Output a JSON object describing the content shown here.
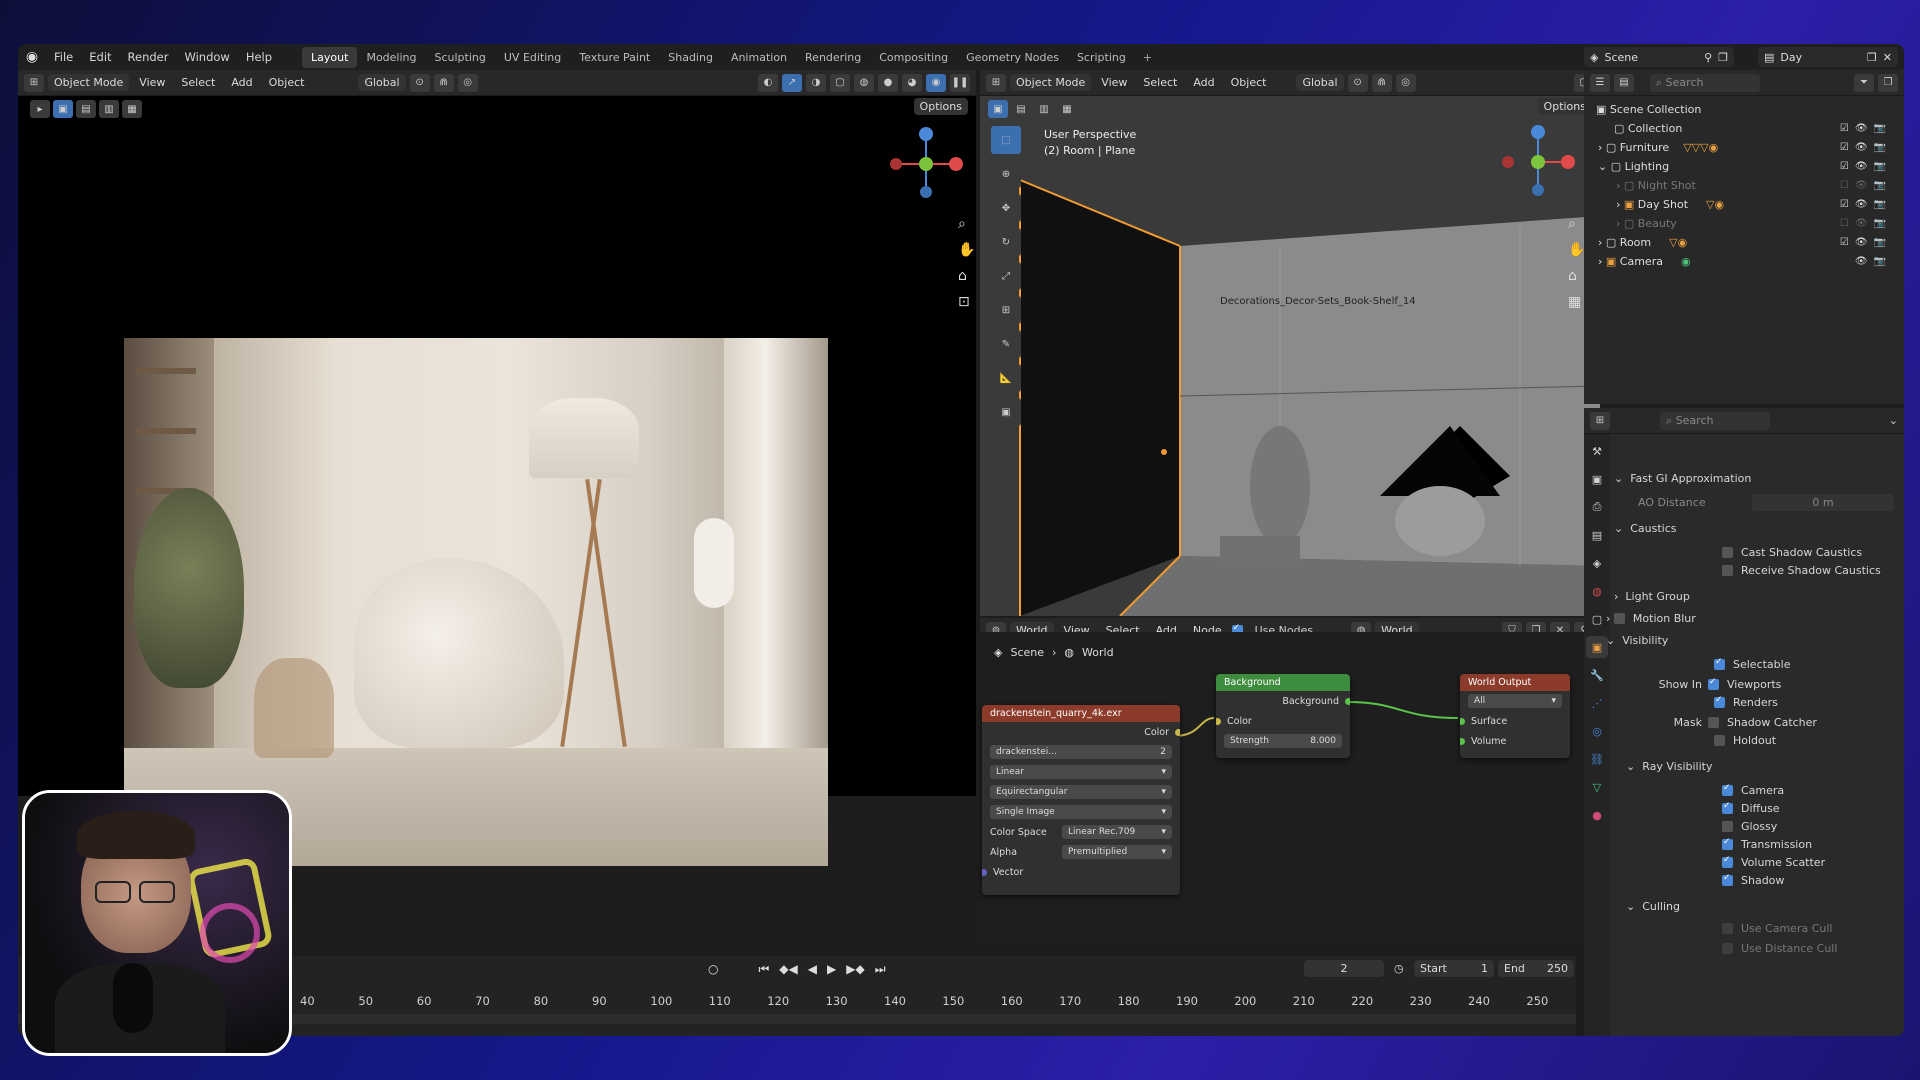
{
  "menu": [
    "File",
    "Edit",
    "Render",
    "Window",
    "Help"
  ],
  "workspaces": [
    "Layout",
    "Modeling",
    "Sculpting",
    "UV Editing",
    "Texture Paint",
    "Shading",
    "Animation",
    "Rendering",
    "Compositing",
    "Geometry Nodes",
    "Scripting"
  ],
  "active_workspace": "Layout",
  "scene_name": "Scene",
  "view_layer": "Day",
  "left_header": {
    "mode": "Object Mode",
    "view": "View",
    "select": "Select",
    "add": "Add",
    "object": "Object",
    "orientation": "Global",
    "options": "Options"
  },
  "right_header": {
    "mode": "Object Mode",
    "view": "View",
    "select": "Select",
    "add": "Add",
    "object": "Object",
    "orientation": "Global",
    "options": "Options"
  },
  "viewport": {
    "perspective": "User Perspective",
    "object_info": "(2) Room | Plane",
    "object_label": "Decorations_Decor-Sets_Book-Shelf_14"
  },
  "node_editor": {
    "type": "World",
    "view": "View",
    "select": "Select",
    "add": "Add",
    "node": "Node",
    "use_nodes": "Use Nodes",
    "world_name": "World",
    "breadcrumb_scene": "Scene",
    "breadcrumb_world": "World",
    "env_node": {
      "title": "drackenstein_quarry_4k.exr",
      "color_out": "Color",
      "image_name": "drackenstei...",
      "users": "2",
      "interpolation": "Linear",
      "projection": "Equirectangular",
      "source": "Single Image",
      "color_space_label": "Color Space",
      "color_space": "Linear Rec.709",
      "alpha_label": "Alpha",
      "alpha": "Premultiplied",
      "vector": "Vector"
    },
    "bg_node": {
      "title": "Background",
      "out": "Background",
      "color": "Color",
      "strength_label": "Strength",
      "strength": "8.000"
    },
    "out_node": {
      "title": "World Output",
      "target": "All",
      "surface": "Surface",
      "volume": "Volume"
    }
  },
  "timeline": {
    "ticks": [
      "40",
      "50",
      "60",
      "70",
      "80",
      "90",
      "100",
      "110",
      "120",
      "130",
      "140",
      "150",
      "160",
      "170",
      "180",
      "190",
      "200",
      "210",
      "220",
      "230",
      "240",
      "250"
    ],
    "current_frame": "2",
    "start_label": "Start",
    "start": "1",
    "end_label": "End",
    "end": "250"
  },
  "outliner": {
    "search": "Search",
    "items": [
      {
        "label": "Scene Collection"
      },
      {
        "label": "Collection"
      },
      {
        "label": "Furniture"
      },
      {
        "label": "Lighting"
      },
      {
        "label": "Night Shot"
      },
      {
        "label": "Day Shot"
      },
      {
        "label": "Beauty"
      },
      {
        "label": "Room"
      },
      {
        "label": "Camera"
      }
    ]
  },
  "properties": {
    "search": "Search",
    "fast_gi": "Fast GI Approximation",
    "ao_distance_label": "AO Distance",
    "ao_distance": "0 m",
    "caustics": "Caustics",
    "cast_shadow_caustics": "Cast Shadow Caustics",
    "receive_shadow_caustics": "Receive Shadow Caustics",
    "light_group": "Light Group",
    "motion_blur": "Motion Blur",
    "visibility": "Visibility",
    "selectable": "Selectable",
    "show_in": "Show In",
    "viewports": "Viewports",
    "renders": "Renders",
    "mask": "Mask",
    "shadow_catcher": "Shadow Catcher",
    "holdout": "Holdout",
    "ray_visibility": "Ray Visibility",
    "camera": "Camera",
    "diffuse": "Diffuse",
    "glossy": "Glossy",
    "transmission": "Transmission",
    "volume_scatter": "Volume Scatter",
    "shadow": "Shadow",
    "culling": "Culling",
    "use_camera_cull": "Use Camera Cull",
    "use_distance_cull": "Use Distance Cull"
  },
  "colors": {
    "accent_blue": "#4a88d8",
    "selection_orange": "#f29b30",
    "node_green": "#3e8c3e",
    "node_red": "#8c3a2a"
  }
}
